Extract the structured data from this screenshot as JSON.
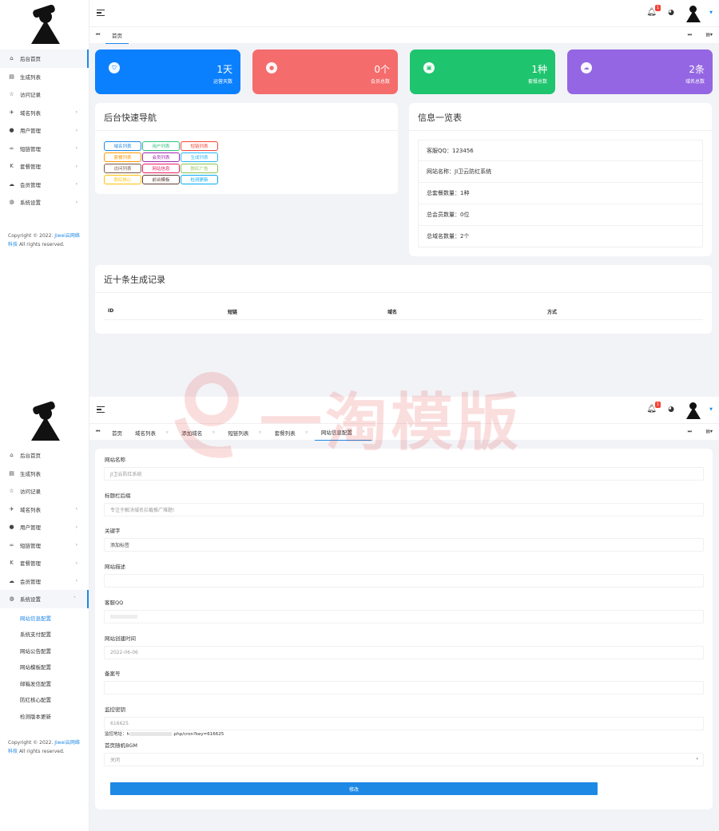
{
  "colors": {
    "accent": "#1e88e5",
    "card_blue": "#0b80ff",
    "card_red": "#f56c6c",
    "card_green": "#1fc46e",
    "card_purple": "#9466e3"
  },
  "top": {
    "sidebar": {
      "items": [
        {
          "icon": "home-icon",
          "label": "后台首页",
          "active": true
        },
        {
          "icon": "list-icon",
          "label": "生成列表"
        },
        {
          "icon": "star-icon",
          "label": "访问记录"
        },
        {
          "icon": "paper-plane-icon",
          "label": "域名列表",
          "caret": "›"
        },
        {
          "icon": "user-icon",
          "label": "用户管理",
          "caret": "›"
        },
        {
          "icon": "link-icon",
          "label": "短链管理",
          "caret": "›"
        },
        {
          "icon": "k-icon",
          "label": "套餐管理",
          "caret": "›"
        },
        {
          "icon": "cloud-icon",
          "label": "会员管理",
          "caret": "›"
        },
        {
          "icon": "globe-icon",
          "label": "系统设置",
          "caret": "›"
        }
      ]
    },
    "copyright": {
      "prefix": "Copyright © 2022.",
      "company": "Jiwei云网络科技",
      "suffix": "All rights reserved."
    },
    "header": {
      "notifications": "1"
    },
    "tabs": [
      {
        "label": "首页",
        "active": true
      }
    ],
    "stats": [
      {
        "icon": "shield-icon",
        "value": "1天",
        "label": "运营天数",
        "color": "#0b80ff"
      },
      {
        "icon": "user-icon",
        "value": "0个",
        "label": "会员总数",
        "color": "#f56c6c"
      },
      {
        "icon": "box-icon",
        "value": "1种",
        "label": "套餐总数",
        "color": "#1fc46e"
      },
      {
        "icon": "cloud-icon",
        "value": "2条",
        "label": "域名总数",
        "color": "#9466e3"
      }
    ],
    "quick_nav": {
      "title": "后台快速导航",
      "buttons": [
        {
          "label": "域名列表",
          "color": "#1e88e5"
        },
        {
          "label": "用户列表",
          "color": "#2ec27e"
        },
        {
          "label": "短链列表",
          "color": "#f44336"
        },
        {
          "label": "套餐列表",
          "color": "#ff9800"
        },
        {
          "label": "会员列表",
          "color": "#9c27b0"
        },
        {
          "label": "生成列表",
          "color": "#29b6f6"
        },
        {
          "label": "访问列表",
          "color": "#795548"
        },
        {
          "label": "网站信息",
          "color": "#e91e63"
        },
        {
          "label": "防红广告",
          "color": "#8bc34a"
        },
        {
          "label": "防红核心",
          "color": "#ffc107"
        },
        {
          "label": "前台模板",
          "color": "#5d4037"
        },
        {
          "label": "检测更新",
          "color": "#03a9f4"
        }
      ]
    },
    "info": {
      "title": "信息一览表",
      "rows": [
        "客服QQ：123456",
        "网站名称：JI卫云防红系统",
        "总套餐数量：1种",
        "总会员数量：0位",
        "总域名数量：2个"
      ]
    },
    "records": {
      "title": "近十条生成记录",
      "columns": [
        "ID",
        "短链",
        "域名",
        "方式"
      ]
    }
  },
  "bottom": {
    "sidebar": {
      "items": [
        {
          "icon": "home-icon",
          "label": "后台首页"
        },
        {
          "icon": "list-icon",
          "label": "生成列表"
        },
        {
          "icon": "star-icon",
          "label": "访问记录"
        },
        {
          "icon": "paper-plane-icon",
          "label": "域名列表",
          "caret": "›"
        },
        {
          "icon": "user-icon",
          "label": "用户管理",
          "caret": "›"
        },
        {
          "icon": "link-icon",
          "label": "短链管理",
          "caret": "›"
        },
        {
          "icon": "k-icon",
          "label": "套餐管理",
          "caret": "›"
        },
        {
          "icon": "cloud-icon",
          "label": "会员管理",
          "caret": "›"
        },
        {
          "icon": "globe-icon",
          "label": "系统设置",
          "caret": "˅",
          "active": true
        }
      ],
      "sub_items": [
        {
          "label": "网站信息配置",
          "active": true
        },
        {
          "label": "系统支付配置"
        },
        {
          "label": "网站公告配置"
        },
        {
          "label": "网站模板配置"
        },
        {
          "label": "邮箱发信配置"
        },
        {
          "label": "防红核心配置"
        },
        {
          "label": "检测版本更新"
        }
      ]
    },
    "copyright": {
      "prefix": "Copyright © 2022.",
      "company": "Jiwei云网络科技",
      "suffix": "All rights reserved."
    },
    "header": {
      "notifications": "1"
    },
    "tabs": [
      {
        "label": "首页"
      },
      {
        "label": "域名列表",
        "close": "×"
      },
      {
        "label": "添加域名",
        "close": "×"
      },
      {
        "label": "短链列表",
        "close": "×"
      },
      {
        "label": "套餐列表",
        "close": "×"
      },
      {
        "label": "网站信息配置",
        "close": "×",
        "active": true
      }
    ],
    "form": {
      "fields": [
        {
          "label": "网站名称",
          "value": "JI卫云防红系统"
        },
        {
          "label": "标题栏后缀",
          "value": "专注于解决域名拦截推广难题!"
        },
        {
          "label": "关键字",
          "value": "添加标签",
          "dark": true
        },
        {
          "label": "网站描述",
          "value": ""
        },
        {
          "label": "客服QQ",
          "value": ""
        },
        {
          "label": "网站创建时间",
          "value": "2022-06-06"
        },
        {
          "label": "备案号",
          "value": ""
        },
        {
          "label": "监控密钥",
          "value": "616625"
        },
        {
          "label": "首页随机BGM",
          "value": "关闭",
          "select": true
        }
      ],
      "monitor_hint_prefix": "监控地址：",
      "monitor_hint_host": "h",
      "monitor_hint_path": ".php/cron?key=616625",
      "submit_label": "修改"
    }
  },
  "watermark": {
    "text": "一淘模版"
  }
}
